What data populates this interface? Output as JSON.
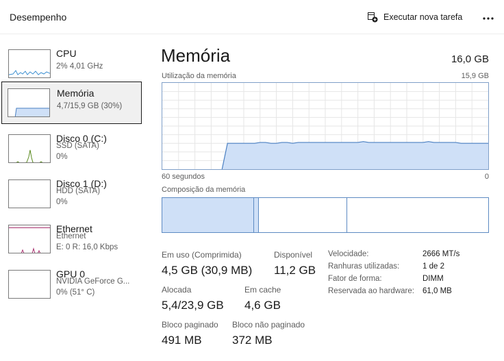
{
  "header": {
    "title": "Desempenho",
    "run_task_label": "Executar nova tarefa",
    "run_task_icon": "run-new-task-icon",
    "more_icon": "more-options-icon"
  },
  "sidebar": {
    "items": [
      {
        "name": "CPU",
        "line1": "2% 4,01 GHz",
        "line2": ""
      },
      {
        "name": "Memória",
        "line1": "4,7/15,9 GB (30%)",
        "line2": ""
      },
      {
        "name": "Disco 0 (C:)",
        "line1": "SSD (SATA)",
        "line2": "0%"
      },
      {
        "name": "Disco 1 (D:)",
        "line1": "HDD (SATA)",
        "line2": "0%"
      },
      {
        "name": "Ethernet",
        "line1": "Ethernet",
        "line2": "E: 0 R: 16,0 Kbps"
      },
      {
        "name": "GPU 0",
        "line1": "NVIDIA GeForce G...",
        "line2": "0% (51° C)"
      }
    ]
  },
  "main": {
    "title": "Memória",
    "total": "16,0 GB",
    "usage_label": "Utilização da memória",
    "usage_max": "15,9 GB",
    "time_span": "60 segundos",
    "time_end": "0",
    "composition_label": "Composição da memória",
    "usage_history_fraction": [
      0,
      0,
      0,
      0,
      0,
      0,
      0,
      0,
      0,
      0,
      0,
      0,
      0.3,
      0.3,
      0.3,
      0.3,
      0.3,
      0.3,
      0.31,
      0.31,
      0.3,
      0.3,
      0.31,
      0.31,
      0.3,
      0.31,
      0.31,
      0.31,
      0.31,
      0.31,
      0.31,
      0.31,
      0.31,
      0.31,
      0.31,
      0.31,
      0.31,
      0.32,
      0.31,
      0.31,
      0.31,
      0.31,
      0.31,
      0.31,
      0.31,
      0.31,
      0.31,
      0.31,
      0.31,
      0.32,
      0.31,
      0.31,
      0.31,
      0.31,
      0.31,
      0.3,
      0.3,
      0.3,
      0.3,
      0.3,
      0.3
    ]
  },
  "stats": {
    "in_use_label": "Em uso (Comprimida)",
    "in_use_value": "4,5 GB (30,9 MB)",
    "available_label": "Disponível",
    "available_value": "11,2 GB",
    "committed_label": "Alocada",
    "committed_value": "5,4/23,9 GB",
    "cached_label": "Em cache",
    "cached_value": "4,6 GB",
    "paged_label": "Bloco paginado",
    "paged_value": "491 MB",
    "nonpaged_label": "Bloco não paginado",
    "nonpaged_value": "372 MB"
  },
  "specs": {
    "speed_label": "Velocidade:",
    "speed_value": "2666 MT/s",
    "slots_label": "Ranhuras utilizadas:",
    "slots_value": "1 de 2",
    "form_label": "Fator de forma:",
    "form_value": "DIMM",
    "reserved_label": "Reservada ao hardware:",
    "reserved_value": "61,0 MB"
  },
  "colors": {
    "memory_fill": "#cfe0f7",
    "memory_line": "#4a7fc1",
    "cpu_line": "#3c8fd0",
    "disk_line": "#5a8a1f",
    "ethernet_line": "#a8316f",
    "grid": "#e6e6e6"
  }
}
